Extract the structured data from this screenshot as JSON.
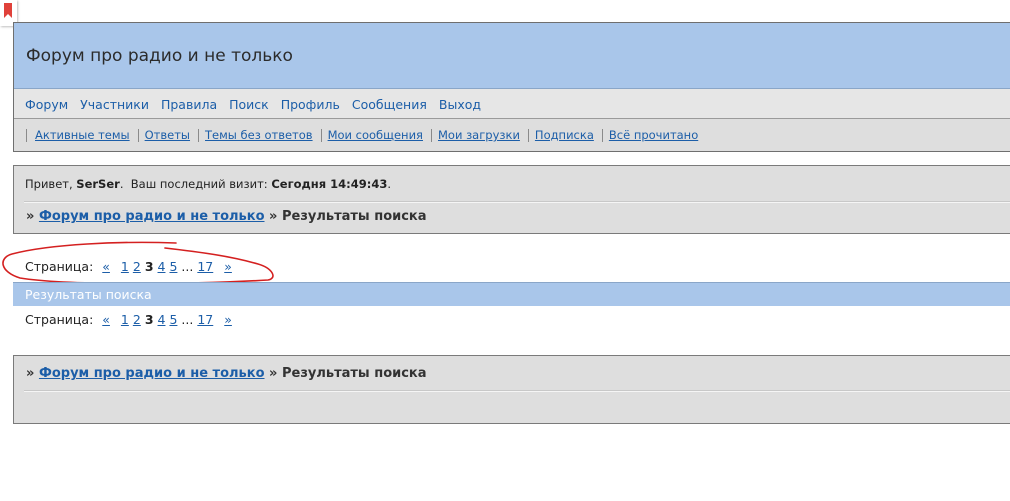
{
  "bookmark": {
    "icon": "bookmark-icon"
  },
  "forum": {
    "title": "Форум про радио и не только"
  },
  "main_nav": [
    {
      "label": "Форум"
    },
    {
      "label": "Участники"
    },
    {
      "label": "Правила"
    },
    {
      "label": "Поиск"
    },
    {
      "label": "Профиль"
    },
    {
      "label": "Сообщения"
    },
    {
      "label": "Выход"
    }
  ],
  "sub_nav": [
    {
      "label": "Активные темы"
    },
    {
      "label": "Ответы"
    },
    {
      "label": "Темы без ответов"
    },
    {
      "label": "Мои сообщения"
    },
    {
      "label": "Мои загрузки"
    },
    {
      "label": "Подписка"
    },
    {
      "label": "Всё прочитано"
    }
  ],
  "greeting": {
    "prefix": "Привет,",
    "user": "SerSer",
    "visit_label": "Ваш последний визит:",
    "visit_time": "Сегодня 14:49:43"
  },
  "breadcrumb": {
    "arrow": "»",
    "forum_link": "Форум про радио и не только",
    "current": "» Результаты поиска"
  },
  "pagination": {
    "label": "Страница:",
    "prev": "«",
    "pages": [
      "1",
      "2"
    ],
    "current": "3",
    "pages_after": [
      "4",
      "5"
    ],
    "ellipsis": "...",
    "last": "17",
    "next": "»"
  },
  "results": {
    "title": "Результаты поиска"
  },
  "colors": {
    "header_blue": "#a9c6ea",
    "link": "#1c5ea8",
    "panel_gray": "#dedede",
    "annotation_red": "#d42020"
  }
}
